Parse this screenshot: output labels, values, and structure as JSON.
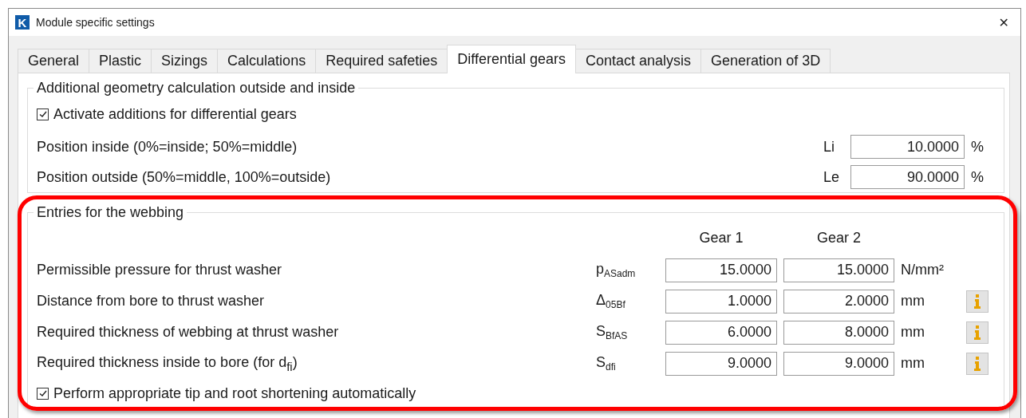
{
  "window": {
    "logo_text": "K",
    "title": "Module specific settings",
    "close_glyph": "✕"
  },
  "tabs": [
    {
      "label": "General",
      "selected": false
    },
    {
      "label": "Plastic",
      "selected": false
    },
    {
      "label": "Sizings",
      "selected": false
    },
    {
      "label": "Calculations",
      "selected": false
    },
    {
      "label": "Required safeties",
      "selected": false
    },
    {
      "label": "Differential gears",
      "selected": true
    },
    {
      "label": "Contact analysis",
      "selected": false
    },
    {
      "label": "Generation of 3D",
      "selected": false
    }
  ],
  "geometry_group": {
    "title": "Additional geometry calculation outside and inside",
    "checkbox": {
      "label": "Activate additions for differential gears",
      "checked": true
    },
    "rows": [
      {
        "label": "Position inside (0%=inside; 50%=middle)",
        "symbol": "Li",
        "value": "10.0000",
        "unit": "%"
      },
      {
        "label": "Position outside (50%=middle, 100%=outside)",
        "symbol": "Le",
        "value": "90.0000",
        "unit": "%"
      }
    ]
  },
  "webbing_group": {
    "title": "Entries for the webbing",
    "columns": [
      "Gear 1",
      "Gear 2"
    ],
    "rows": [
      {
        "label": "Permissible pressure for thrust washer",
        "symbol": "p$_{ASadm}$",
        "values": [
          "15.0000",
          "15.0000"
        ],
        "unit": "N/mm²",
        "info": false
      },
      {
        "label": "Distance from bore to thrust washer",
        "symbol": "Δ$_{05Bf}$",
        "values": [
          "1.0000",
          "2.0000"
        ],
        "unit": "mm",
        "info": true
      },
      {
        "label": "Required thickness of webbing at thrust washer",
        "symbol": "S$_{BfAS}$",
        "values": [
          "6.0000",
          "8.0000"
        ],
        "unit": "mm",
        "info": true
      },
      {
        "label": "Required thickness inside to bore (for d$_{fi}$)",
        "symbol": "S$_{dfi}$",
        "values": [
          "9.0000",
          "9.0000"
        ],
        "unit": "mm",
        "info": true
      }
    ],
    "checkbox": {
      "label": "Perform appropriate tip and root shortening automatically",
      "checked": true
    }
  }
}
